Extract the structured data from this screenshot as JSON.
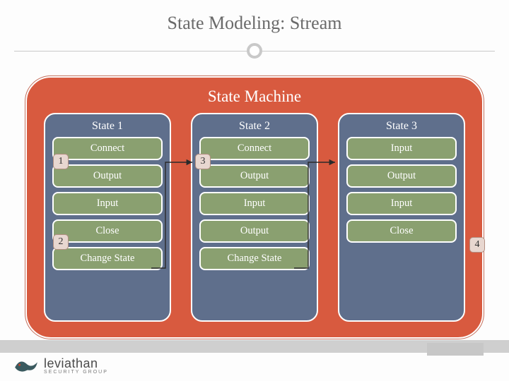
{
  "title": "State Modeling: Stream",
  "machine": {
    "title": "State Machine",
    "states": [
      {
        "header": "State 1",
        "steps": [
          "Connect",
          "Output",
          "Input",
          "Close",
          "Change State"
        ]
      },
      {
        "header": "State 2",
        "steps": [
          "Connect",
          "Output",
          "Input",
          "Output",
          "Change State"
        ]
      },
      {
        "header": "State 3",
        "steps": [
          "Input",
          "Output",
          "Input",
          "Close"
        ]
      }
    ]
  },
  "badges": {
    "b1": "1",
    "b2": "2",
    "b3": "3",
    "b4": "4"
  },
  "logo": {
    "name": "leviathan",
    "sub": "SECURITY GROUP"
  }
}
